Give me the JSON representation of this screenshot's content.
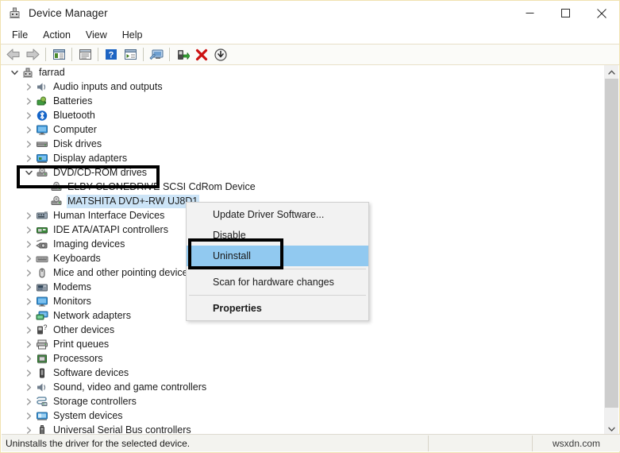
{
  "window": {
    "title": "Device Manager",
    "icon": "device-manager-icon",
    "border_color": "#f0e2b0",
    "controls": [
      {
        "name": "minimize",
        "glyph": "minimize-icon"
      },
      {
        "name": "maximize",
        "glyph": "maximize-icon"
      },
      {
        "name": "close",
        "glyph": "close-icon"
      }
    ]
  },
  "menubar": {
    "items": [
      {
        "label": "File"
      },
      {
        "label": "Action"
      },
      {
        "label": "View"
      },
      {
        "label": "Help"
      }
    ]
  },
  "toolbar": {
    "buttons": [
      {
        "name": "back-icon"
      },
      {
        "name": "forward-icon"
      },
      {
        "sep": true
      },
      {
        "name": "show-hide-console-tree-icon"
      },
      {
        "sep": true
      },
      {
        "name": "properties-icon"
      },
      {
        "sep": true
      },
      {
        "name": "help-icon"
      },
      {
        "name": "view-details-icon"
      },
      {
        "sep": true
      },
      {
        "name": "scan-for-hardware-changes-icon"
      },
      {
        "sep": true
      },
      {
        "name": "update-driver-icon"
      },
      {
        "name": "uninstall-device-icon"
      },
      {
        "name": "disable-device-icon"
      }
    ]
  },
  "tree": {
    "items": [
      {
        "label": "farrad",
        "indent": 0,
        "state": "expanded",
        "icon": "computer-node-icon",
        "selected": false
      },
      {
        "label": "Audio inputs and outputs",
        "indent": 1,
        "state": "collapsed",
        "icon": "speaker-icon",
        "selected": false
      },
      {
        "label": "Batteries",
        "indent": 1,
        "state": "collapsed",
        "icon": "battery-icon",
        "selected": false
      },
      {
        "label": "Bluetooth",
        "indent": 1,
        "state": "collapsed",
        "icon": "bluetooth-icon",
        "selected": false
      },
      {
        "label": "Computer",
        "indent": 1,
        "state": "collapsed",
        "icon": "monitor-icon",
        "selected": false
      },
      {
        "label": "Disk drives",
        "indent": 1,
        "state": "collapsed",
        "icon": "disk-drive-icon",
        "selected": false
      },
      {
        "label": "Display adapters",
        "indent": 1,
        "state": "collapsed",
        "icon": "display-adapter-icon",
        "selected": false
      },
      {
        "label": "DVD/CD-ROM drives",
        "indent": 1,
        "state": "expanded",
        "icon": "optical-drive-icon",
        "selected": false
      },
      {
        "label": "ELBY CLONEDRIVE SCSI CdRom Device",
        "indent": 2,
        "state": "leaf",
        "icon": "optical-drive-icon",
        "selected": false
      },
      {
        "label": "MATSHITA DVD+-RW UJ8D1",
        "indent": 2,
        "state": "leaf",
        "icon": "optical-drive-icon",
        "selected": true
      },
      {
        "label": "Human Interface Devices",
        "indent": 1,
        "state": "collapsed",
        "icon": "hid-icon",
        "selected": false
      },
      {
        "label": "IDE ATA/ATAPI controllers",
        "indent": 1,
        "state": "collapsed",
        "icon": "ide-controller-icon",
        "selected": false
      },
      {
        "label": "Imaging devices",
        "indent": 1,
        "state": "collapsed",
        "icon": "camera-icon",
        "selected": false
      },
      {
        "label": "Keyboards",
        "indent": 1,
        "state": "collapsed",
        "icon": "keyboard-icon",
        "selected": false
      },
      {
        "label": "Mice and other pointing devices",
        "indent": 1,
        "state": "collapsed",
        "icon": "mouse-icon",
        "selected": false
      },
      {
        "label": "Modems",
        "indent": 1,
        "state": "collapsed",
        "icon": "modem-icon",
        "selected": false
      },
      {
        "label": "Monitors",
        "indent": 1,
        "state": "collapsed",
        "icon": "monitor-icon",
        "selected": false
      },
      {
        "label": "Network adapters",
        "indent": 1,
        "state": "collapsed",
        "icon": "network-adapter-icon",
        "selected": false
      },
      {
        "label": "Other devices",
        "indent": 1,
        "state": "collapsed",
        "icon": "unknown-device-icon",
        "selected": false
      },
      {
        "label": "Print queues",
        "indent": 1,
        "state": "collapsed",
        "icon": "printer-icon",
        "selected": false
      },
      {
        "label": "Processors",
        "indent": 1,
        "state": "collapsed",
        "icon": "processor-icon",
        "selected": false
      },
      {
        "label": "Software devices",
        "indent": 1,
        "state": "collapsed",
        "icon": "software-device-icon",
        "selected": false
      },
      {
        "label": "Sound, video and game controllers",
        "indent": 1,
        "state": "collapsed",
        "icon": "speaker-icon",
        "selected": false
      },
      {
        "label": "Storage controllers",
        "indent": 1,
        "state": "collapsed",
        "icon": "storage-controller-icon",
        "selected": false
      },
      {
        "label": "System devices",
        "indent": 1,
        "state": "collapsed",
        "icon": "system-device-icon",
        "selected": false
      },
      {
        "label": "Universal Serial Bus controllers",
        "indent": 1,
        "state": "collapsed",
        "icon": "usb-icon",
        "selected": false
      }
    ]
  },
  "context_menu": {
    "items": [
      {
        "label": "Update Driver Software...",
        "highlighted": false,
        "bold": false,
        "separator_after": false
      },
      {
        "label": "Disable",
        "highlighted": false,
        "bold": false,
        "separator_after": false
      },
      {
        "label": "Uninstall",
        "highlighted": true,
        "bold": false,
        "separator_after": true
      },
      {
        "label": "Scan for hardware changes",
        "highlighted": false,
        "bold": false,
        "separator_after": true
      },
      {
        "label": "Properties",
        "highlighted": false,
        "bold": true,
        "separator_after": false
      }
    ],
    "highlight_color": "#91c9f0"
  },
  "annotations": [
    {
      "name": "dvd-cdrom-drives-callout",
      "target": "DVD/CD-ROM drives",
      "color": "#000000"
    },
    {
      "name": "uninstall-callout",
      "target": "Uninstall",
      "color": "#000000"
    }
  ],
  "statusbar": {
    "message": "Uninstalls the driver for the selected device.",
    "watermark": "wsxdn.com"
  },
  "scrollbar": {
    "up_glyph": "chevron-up-icon",
    "down_glyph": "chevron-down-icon"
  }
}
